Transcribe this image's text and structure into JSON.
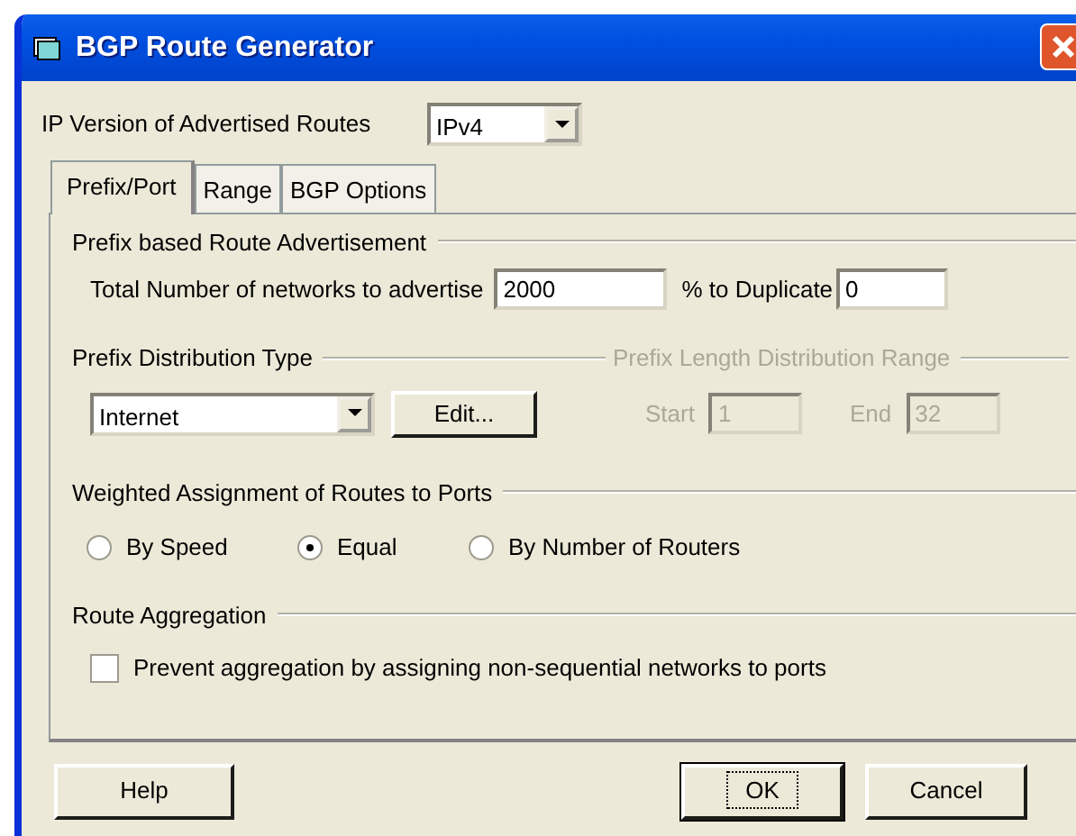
{
  "window": {
    "title": "BGP Route Generator"
  },
  "ip_version": {
    "label": "IP Version of Advertised Routes",
    "value": "IPv4"
  },
  "tabs": [
    {
      "label": "Prefix/Port",
      "selected": true
    },
    {
      "label": "Range",
      "selected": false
    },
    {
      "label": "BGP Options",
      "selected": false
    }
  ],
  "prefix_advertisement": {
    "title": "Prefix based Route Advertisement",
    "fields": [
      {
        "label": "Total Number of networks to advertise",
        "value": "2000"
      },
      {
        "label": "% to Duplicate",
        "value": "0"
      }
    ]
  },
  "prefix_distribution": {
    "title": "Prefix Distribution Type",
    "value": "Internet",
    "edit_button": "Edit..."
  },
  "length_range": {
    "title": "Prefix Length Distribution Range",
    "disabled": true,
    "fields": [
      {
        "label": "Start",
        "value": "1"
      },
      {
        "label": "End",
        "value": "32"
      }
    ]
  },
  "weighted_assignment": {
    "title": "Weighted Assignment of Routes to Ports",
    "options": [
      {
        "label": "By Speed",
        "selected": false
      },
      {
        "label": "Equal",
        "selected": true
      },
      {
        "label": "By Number of Routers",
        "selected": false
      }
    ]
  },
  "route_aggregation": {
    "title": "Route Aggregation",
    "options": [
      {
        "label": "Prevent aggregation by assigning non-sequential networks to ports",
        "checked": false
      }
    ]
  },
  "buttons": [
    {
      "label": "Help",
      "default": false
    },
    {
      "label": "OK",
      "default": true
    },
    {
      "label": "Cancel",
      "default": false
    }
  ]
}
